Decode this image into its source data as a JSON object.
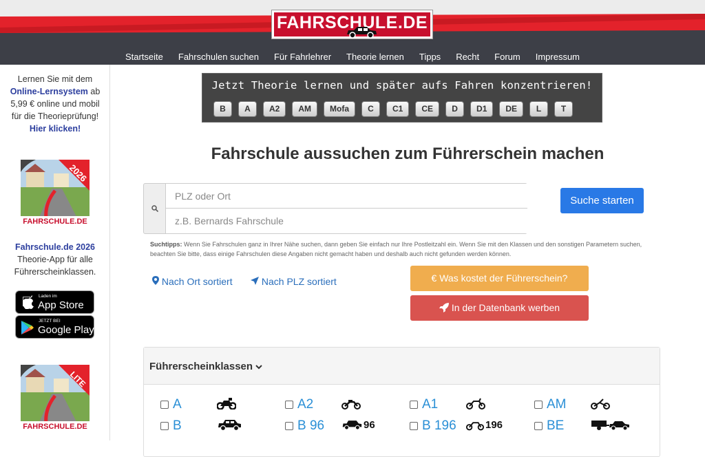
{
  "header": {
    "logo_text": "FAHRSCHULE.DE",
    "nav": [
      "Startseite",
      "Fahrschulen suchen",
      "Für Fahrlehrer",
      "Theorie lernen",
      "Tipps",
      "Recht",
      "Forum",
      "Impressum"
    ]
  },
  "sidebar": {
    "promo_line1": "Lernen Sie mit dem",
    "promo_link": "Online-Lernsystem",
    "promo_line2": "ab",
    "promo_line3": "5,99 € online und mobil",
    "promo_line4": "für die Theorieprüfung!",
    "promo_click": "Hier klicken!",
    "app1_badge": "2026",
    "app1_brand": "FAHRSCHULE.DE",
    "app_title": "Fahrschule.de 2026",
    "app_desc1": "Theorie-App für alle",
    "app_desc2": "Führerscheinklassen.",
    "appstore_small": "Laden im",
    "appstore_big": "App Store",
    "googleplay_small": "JETZT BEI",
    "googleplay_big": "Google Play",
    "app2_badge": "LITE",
    "app2_brand": "FAHRSCHULE.DE"
  },
  "theorie": {
    "title": "Jetzt Theorie lernen und später aufs Fahren konzentrieren!",
    "keys": [
      "B",
      "A",
      "A2",
      "AM",
      "Mofa",
      "C",
      "C1",
      "CE",
      "D",
      "D1",
      "DE",
      "L",
      "T"
    ]
  },
  "main": {
    "heading": "Fahrschule aussuchen zum Führerschein machen",
    "search_placeholder_1": "PLZ oder Ort",
    "search_placeholder_2": "z.B. Bernards Fahrschule",
    "search_button": "Suche starten",
    "tipps_label": "Suchtipps:",
    "tipps_text": "Wenn Sie Fahrschulen ganz in Ihrer Nähe suchen, dann geben Sie einfach nur Ihre Postleitzahl ein. Wenn Sie mit den Klassen und den sonstigen Parametern suchen, beachten Sie bitte, dass einige Fahrschulen diese Angaben nicht gemacht haben und deshalb auch nicht gefunden werden können.",
    "sort_ort": "Nach Ort sortiert",
    "sort_plz": "Nach PLZ sortiert",
    "btn_kosten": "€ Was kostet der Führerschein?",
    "btn_werben": "In der Datenbank werben"
  },
  "klassen": {
    "heading": "Führerscheinklassen",
    "items": [
      {
        "label": "A",
        "icon": "motorcycle-icon",
        "suffix": ""
      },
      {
        "label": "A2",
        "icon": "scooter-icon",
        "suffix": ""
      },
      {
        "label": "A1",
        "icon": "moped-icon",
        "suffix": ""
      },
      {
        "label": "AM",
        "icon": "mofa-icon",
        "suffix": ""
      },
      {
        "label": "B",
        "icon": "car-icon",
        "suffix": ""
      },
      {
        "label": "B 96",
        "icon": "car-icon",
        "suffix": "96"
      },
      {
        "label": "B 196",
        "icon": "moped-icon",
        "suffix": "196"
      },
      {
        "label": "BE",
        "icon": "car-trailer-icon",
        "suffix": ""
      }
    ]
  },
  "colors": {
    "brand_red": "#e3222b",
    "nav_dark": "#3d3f47",
    "link_blue": "#2a6ebb",
    "button_blue": "#2979e6",
    "orange": "#f0ad4e",
    "red": "#d9534f"
  }
}
